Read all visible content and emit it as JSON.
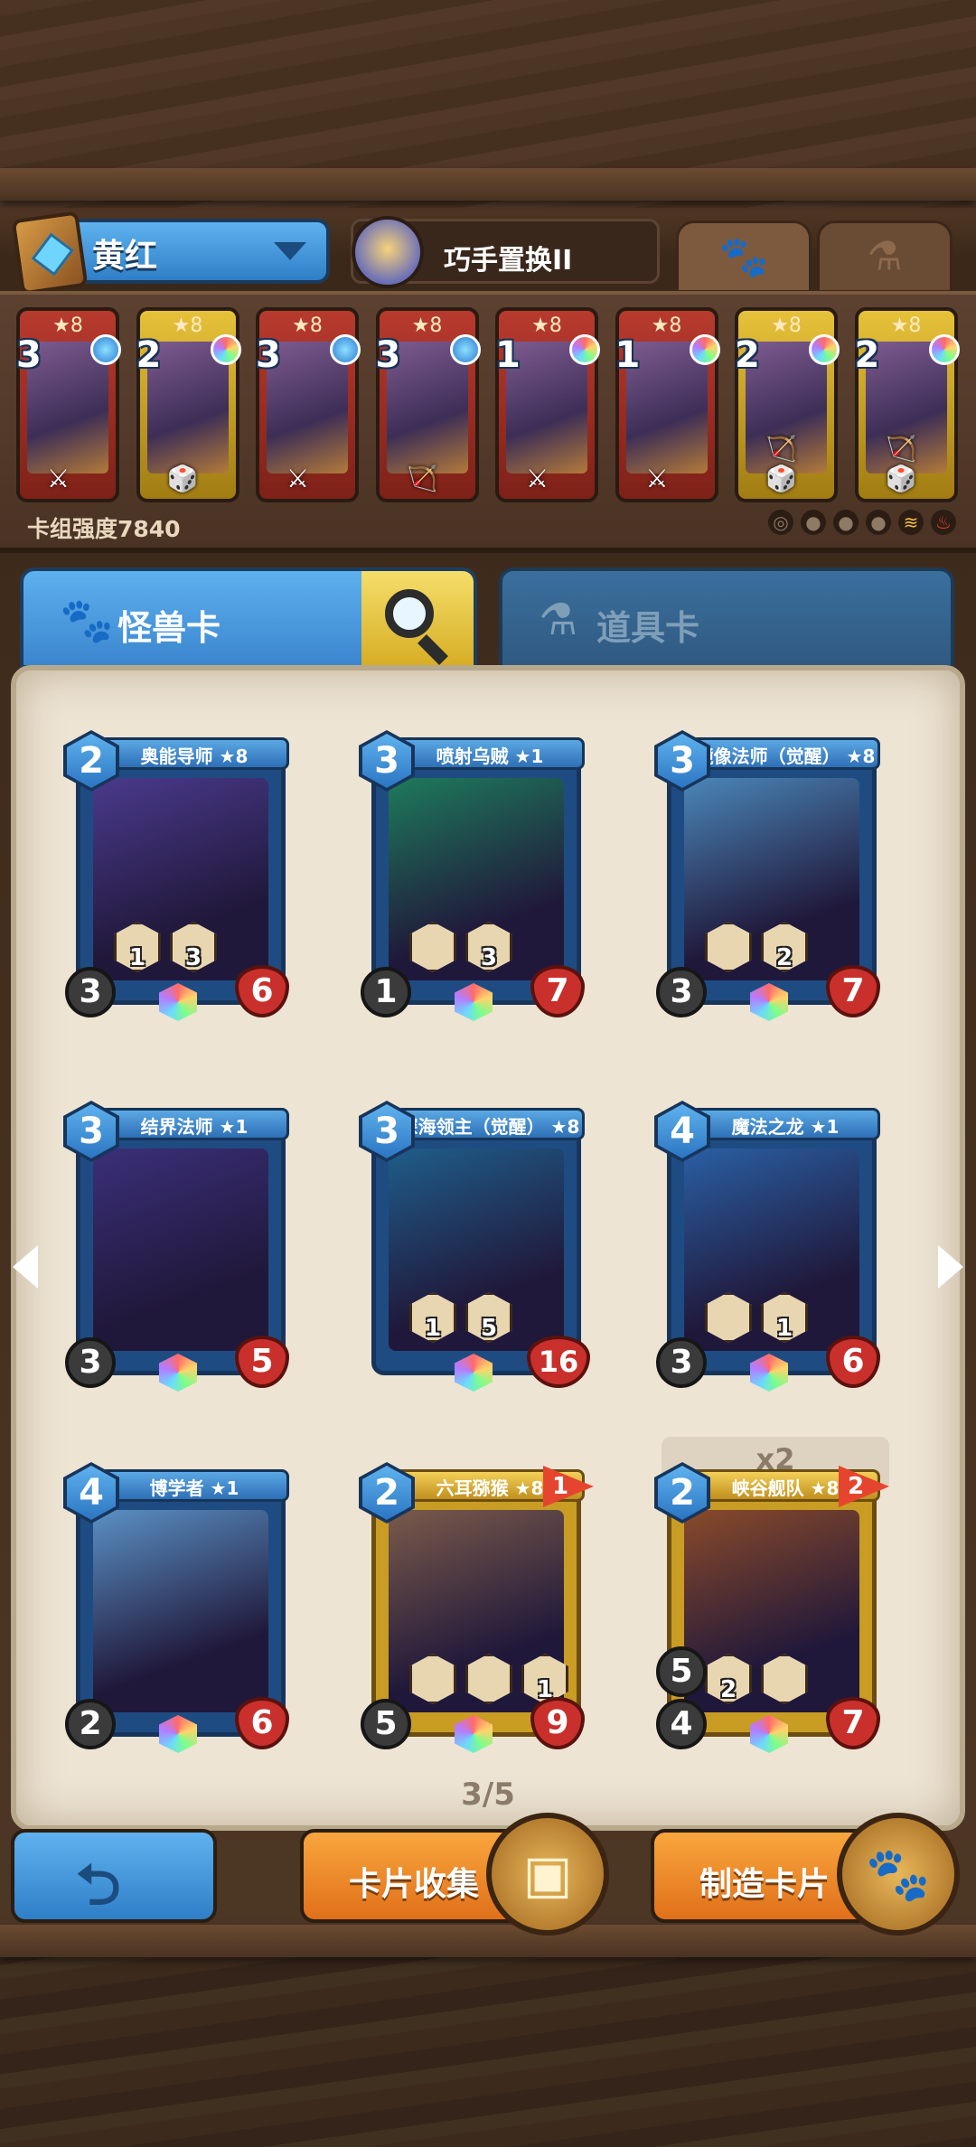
{
  "deck_selector": {
    "name": "黄红"
  },
  "skill": {
    "name": "巧手置换II"
  },
  "top_tabs": [
    {
      "glyph": "🐾"
    },
    {
      "glyph": "⚗"
    }
  ],
  "deck_cards": [
    {
      "cost": "3",
      "stars": "★8",
      "color": "red",
      "gem": "blue",
      "type_icon": "⚔"
    },
    {
      "cost": "2",
      "stars": "★8",
      "color": "yel",
      "gem": "rainbow",
      "type_icon": "🎲"
    },
    {
      "cost": "3",
      "stars": "★8",
      "color": "red",
      "gem": "blue",
      "type_icon": "⚔"
    },
    {
      "cost": "3",
      "stars": "★8",
      "color": "red",
      "gem": "blue",
      "type_icon": "🏹"
    },
    {
      "cost": "1",
      "stars": "★8",
      "color": "red",
      "gem": "rainbow",
      "type_icon": "⚔"
    },
    {
      "cost": "1",
      "stars": "★8",
      "color": "red",
      "gem": "rainbow",
      "type_icon": "⚔"
    },
    {
      "cost": "2",
      "stars": "★8",
      "color": "yel",
      "gem": "rainbow",
      "type_icon": "🏹 🎲"
    },
    {
      "cost": "2",
      "stars": "★8",
      "color": "yel",
      "gem": "rainbow",
      "type_icon": "🏹 🎲"
    }
  ],
  "deck_strength": "卡组强度7840",
  "tabs": {
    "monster": "怪兽卡",
    "item": "道具卡"
  },
  "cards": [
    {
      "title": "奥能导师 ★8",
      "cost": "2",
      "atk": "3",
      "hp": "6",
      "abil": [
        "1",
        "3"
      ],
      "frame": "blue",
      "art": "#4a3a8c"
    },
    {
      "title": "喷射乌贼 ★1",
      "cost": "3",
      "atk": "1",
      "hp": "7",
      "abil": [
        "",
        "3"
      ],
      "frame": "blue",
      "art": "#1e7a5c"
    },
    {
      "title": "镜像法师（觉醒） ★8",
      "cost": "3",
      "atk": "3",
      "hp": "7",
      "abil": [
        "",
        "2"
      ],
      "frame": "blue",
      "art": "#4a86b8"
    },
    {
      "title": "结界法师 ★1",
      "cost": "3",
      "atk": "3",
      "hp": "5",
      "abil": [],
      "frame": "blue",
      "art": "#3b2f79"
    },
    {
      "title": "深海领主（觉醒） ★8",
      "cost": "3",
      "atk": "",
      "hp": "16",
      "abil": [
        "1",
        "5"
      ],
      "frame": "blue",
      "art": "#1f5d8a"
    },
    {
      "title": "魔法之龙 ★1",
      "cost": "4",
      "atk": "3",
      "hp": "6",
      "abil": [
        "",
        "1"
      ],
      "frame": "blue",
      "art": "#2a5fa3"
    },
    {
      "title": "博学者 ★1",
      "cost": "4",
      "atk": "2",
      "hp": "6",
      "abil": [],
      "frame": "blue",
      "art": "#5a90c4"
    },
    {
      "title": "六耳猕猴 ★8",
      "cost": "2",
      "atk": "5",
      "hp": "9",
      "abil": [
        "",
        "",
        "1"
      ],
      "frame": "gold",
      "art": "#7a5a4a",
      "flag": "1"
    },
    {
      "title": "峡谷舰队 ★8",
      "cost": "2",
      "atk": "4",
      "hp": "7",
      "abil": [
        "2",
        ""
      ],
      "frame": "gold",
      "art": "#8a4a2a",
      "flag": "2",
      "extra": "5"
    }
  ],
  "x2_badge": "x2",
  "pager": "3/5",
  "buttons": {
    "collection": "卡片收集",
    "craft": "制造卡片"
  }
}
